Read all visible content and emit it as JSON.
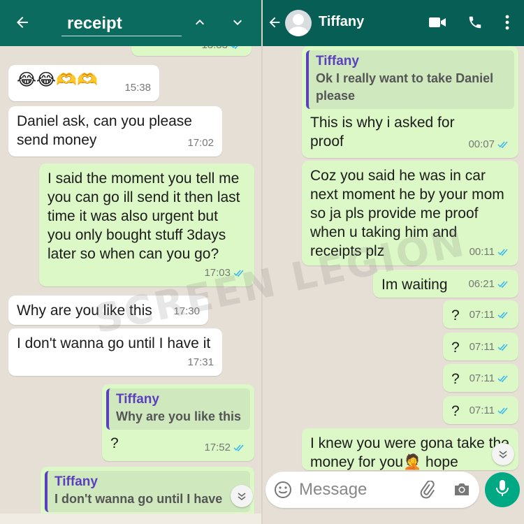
{
  "left_panel": {
    "search": {
      "value": "receipt"
    },
    "partial_top_time": "13:33",
    "messages": [
      {
        "side": "in",
        "text": "😂😂🫶🫶",
        "time": "15:38"
      },
      {
        "side": "in",
        "text": "Daniel ask, can you please send money",
        "time": "17:02"
      },
      {
        "side": "out",
        "text": "I said the moment you tell me you can go ill send it then last time it was also urgent but you only bought stuff 3days later so when can you go?",
        "time": "17:03"
      },
      {
        "side": "in",
        "text": "Why are you like this",
        "time": "17:30"
      },
      {
        "side": "in",
        "text": "I don't wanna go until I have it",
        "time": "17:31"
      },
      {
        "side": "out",
        "quote_name": "Tiffany",
        "quote_text": "Why are you like this",
        "text": "?",
        "time": "17:52"
      },
      {
        "side": "out",
        "quote_name": "Tiffany",
        "quote_text": "I don't wanna go until I have"
      }
    ]
  },
  "right_panel": {
    "contact_name": "Tiffany",
    "messages": [
      {
        "side": "out",
        "quote_name": "Tiffany",
        "quote_text": "Ok I really want to take Daniel please",
        "text": "This is why i asked for proof",
        "time": "00:07"
      },
      {
        "side": "out",
        "text": "Coz you said he was in car next moment he by your mom so ja pls provide me proof when u taking him and receipts plz",
        "time": "00:11"
      },
      {
        "side": "out",
        "text": "Im waiting",
        "time": "06:21"
      },
      {
        "side": "out",
        "text": "?",
        "time": "07:11"
      },
      {
        "side": "out",
        "text": "?",
        "time": "07:11"
      },
      {
        "side": "out",
        "text": "?",
        "time": "07:11"
      },
      {
        "side": "out",
        "text": "?",
        "time": "07:11"
      },
      {
        "side": "out",
        "text": "I knew you were gona take the money for you🤦 hope"
      }
    ],
    "composer": {
      "placeholder": "Message"
    }
  },
  "watermark": "SCREEN LEGION",
  "colors": {
    "header": "#075e54",
    "outgoing": "#dcf8c6",
    "incoming": "#ffffff",
    "tick_read": "#34b7f1",
    "mic": "#00a884",
    "quote_accent": "#5b3fbf"
  },
  "icons": [
    "back-arrow-icon",
    "chevron-up-icon",
    "chevron-down-icon",
    "video-call-icon",
    "phone-icon",
    "more-vert-icon",
    "emoji-icon",
    "attach-icon",
    "camera-icon",
    "mic-icon",
    "double-tick-icon",
    "scroll-down-icon"
  ]
}
